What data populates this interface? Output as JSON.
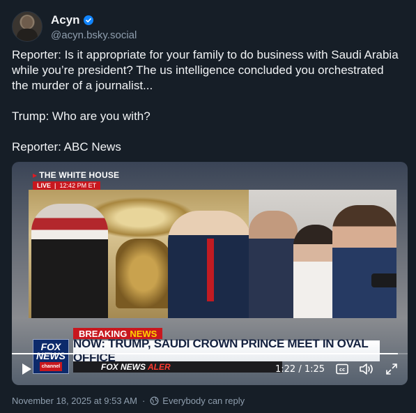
{
  "author": {
    "display_name": "Acyn",
    "handle": "@acyn.bsky.social",
    "verified": true,
    "verified_color": "#1185fe"
  },
  "post": {
    "paragraphs": [
      "Reporter: Is it appropriate for your family to do business with Saudi Arabia while you’re president? The us intelligence concluded you orchestrated the murder of a journalist...",
      "Trump: Who are you with?",
      "Reporter: ABC News"
    ]
  },
  "video": {
    "overlay": {
      "location": "THE WHITE HOUSE",
      "live_label": "LIVE",
      "live_time": "12:42 PM ET",
      "breaking_prefix": "BREAKING",
      "breaking_suffix": "NEWS",
      "headline": "NOW: TRUMP, SAUDI CROWN PRINCE MEET IN OVAL OFFICE",
      "ticker_brand": "FOX NEWS",
      "ticker_alert": "ALER",
      "logo_line1": "FOX",
      "logo_line2": "NEWS",
      "logo_line3": "channel"
    },
    "time_display": "1:22 / 1:25",
    "progress_fraction": 0.976,
    "controls": {
      "play_icon": "play-icon",
      "captions_icon": "closed-captions-icon",
      "volume_icon": "volume-icon",
      "fullscreen_icon": "fullscreen-icon"
    }
  },
  "footer": {
    "timestamp": "November 18, 2025 at 9:53 AM",
    "separator": "·",
    "reply_setting": "Everybody can reply"
  }
}
